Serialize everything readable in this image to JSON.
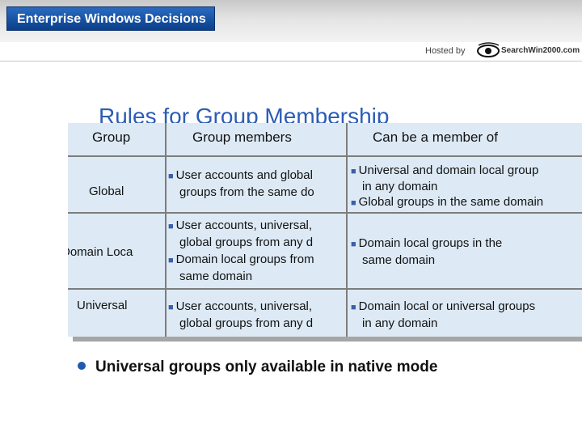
{
  "header": {
    "title_part1": "Enterprise",
    "title_part2": "Windows",
    "title_part3": "Decisions",
    "hosted_label": "Hosted by",
    "sponsor_name": "SearchWin2000.com"
  },
  "slide": {
    "ghost_title": "Rules for Group Membership",
    "columns": [
      "Group",
      "Group members",
      "Can be a member of"
    ],
    "rows": [
      {
        "group": "Global",
        "members": [
          "User accounts and global",
          "groups from the same do"
        ],
        "member_of": [
          "Universal and domain local group",
          "in any domain",
          "Global groups in the same domain"
        ]
      },
      {
        "group": "Domain Loca",
        "members": [
          "User accounts, universal,",
          "global groups from any d",
          "Domain local groups from",
          "same domain"
        ],
        "member_of": [
          "Domain local groups in the",
          "same domain"
        ]
      },
      {
        "group": "Universal",
        "members": [
          "User accounts, universal,",
          "global groups from any d"
        ],
        "member_of": [
          "Domain local or universal groups",
          "in any domain"
        ]
      }
    ],
    "note": "Universal groups only available in native mode"
  },
  "colors": {
    "title_bar": "#0a3f8a",
    "table_fill": "#ddeaf5",
    "bullet_blue": "#3b5fa8",
    "heading_blue": "#2c5db5"
  }
}
